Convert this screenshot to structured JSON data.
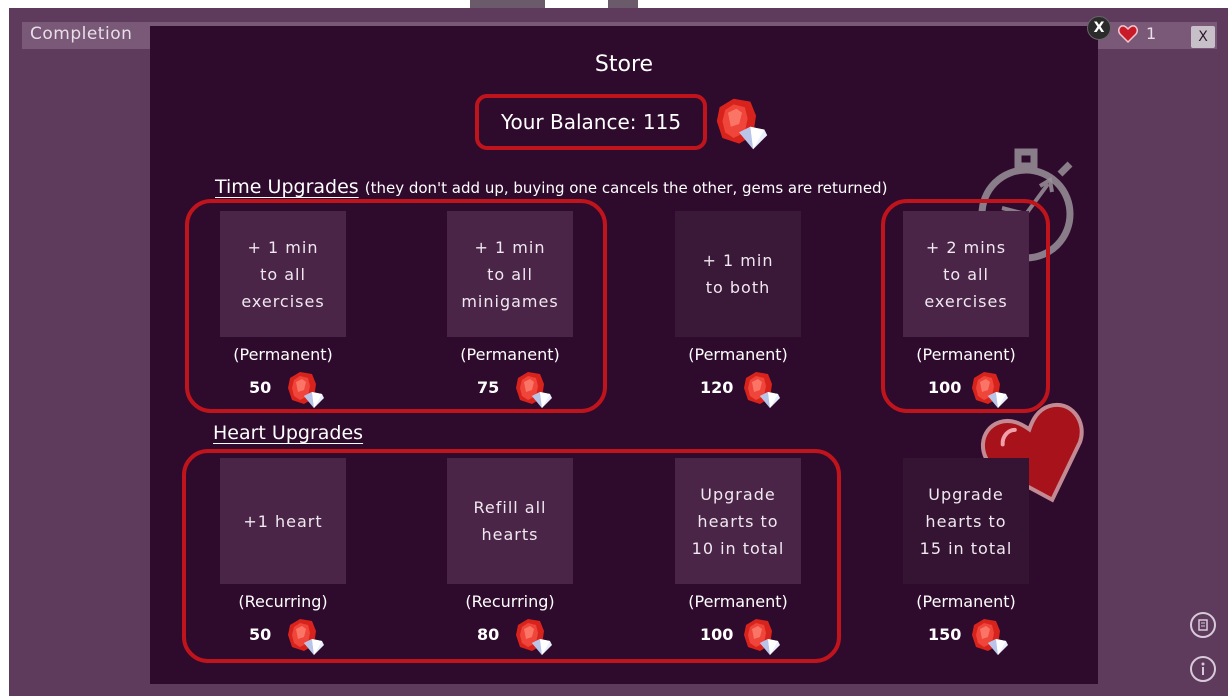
{
  "topbar": {
    "completion_label": "Completion",
    "hearts_count": "1",
    "close_label": "X",
    "overlay_close_label": "X"
  },
  "store": {
    "title": "Store",
    "balance_text": "Your Balance: 115"
  },
  "time_upgrades": {
    "title": "Time Upgrades",
    "note": "(they don't add up, buying one cancels the other, gems are returned)",
    "items": [
      {
        "label": "+ 1 min\nto all\nexercises",
        "kind": "(Permanent)",
        "price": "50"
      },
      {
        "label": "+ 1 min\nto all\nminigames",
        "kind": "(Permanent)",
        "price": "75"
      },
      {
        "label": "+ 1 min\nto both",
        "kind": "(Permanent)",
        "price": "120"
      },
      {
        "label": "+ 2 mins\nto all\nexercises",
        "kind": "(Permanent)",
        "price": "100"
      }
    ]
  },
  "heart_upgrades": {
    "title": "Heart Upgrades",
    "items": [
      {
        "label": "+1 heart",
        "kind": "(Recurring)",
        "price": "50"
      },
      {
        "label": "Refill all\nhearts",
        "kind": "(Recurring)",
        "price": "80"
      },
      {
        "label": "Upgrade\nhearts to\n10 in total",
        "kind": "(Permanent)",
        "price": "100"
      },
      {
        "label": "Upgrade\nhearts to\n15 in total",
        "kind": "(Permanent)",
        "price": "150"
      }
    ]
  },
  "colors": {
    "accent_red": "#c0141c",
    "modal_bg": "#2e0a2c",
    "card_bg": "#4a2548",
    "page_bg": "#5e3a5c"
  }
}
